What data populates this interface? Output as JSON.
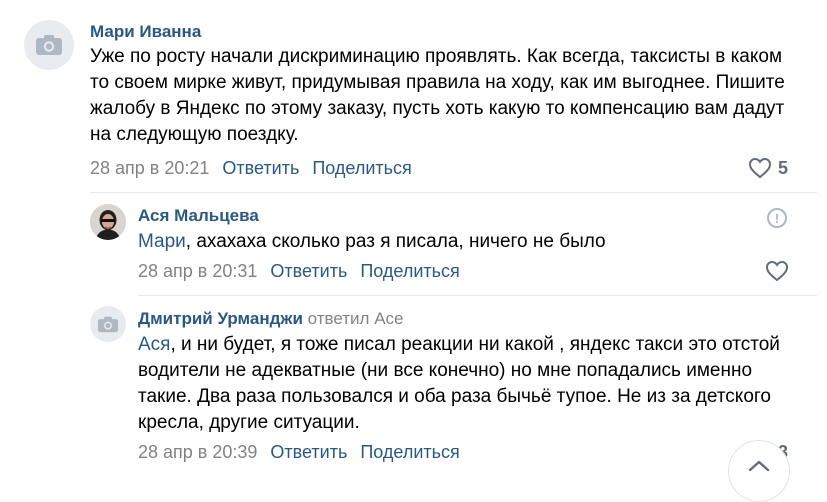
{
  "comments": [
    {
      "author": "Мари Иванна",
      "text": "Уже по росту начали дискриминацию проявлять. Как всегда, таксисты в каком то своем мирке живут, придумывая правила на ходу, как им выгоднее. Пишите жалобу в Яндекс по этому заказу, пусть хоть какую то компенсацию вам дадут на следующую поездку.",
      "date": "28 апр в 20:21",
      "reply_label": "Ответить",
      "share_label": "Поделиться",
      "likes": "5",
      "avatar_icon": "camera-icon"
    },
    {
      "author": "Ася Мальцева",
      "mention": "Мари",
      "text": ", ахахаха сколько раз я писала, ничего не было",
      "date": "28 апр в 20:31",
      "reply_label": "Ответить",
      "share_label": "Поделиться",
      "avatar_icon": "user-photo"
    },
    {
      "author": "Дмитрий Урманджи",
      "replied_to": "ответил Асе",
      "mention": "Ася",
      "text": ", и ни будет, я тоже писал реакции ни какой , яндекс такси это отстой водители не адекватные (ни все конечно) но мне попадались именно такие. Два раза пользовался и оба раза бычьё тупое. Не из за детского кресла, другие ситуации.",
      "date": "28 апр в 20:39",
      "reply_label": "Ответить",
      "share_label": "Поделиться",
      "likes": "3",
      "avatar_icon": "camera-icon"
    }
  ],
  "report_icon": "!",
  "colors": {
    "link": "#2a5885",
    "meta": "#828282",
    "avatar_bg": "#e8ebef"
  }
}
